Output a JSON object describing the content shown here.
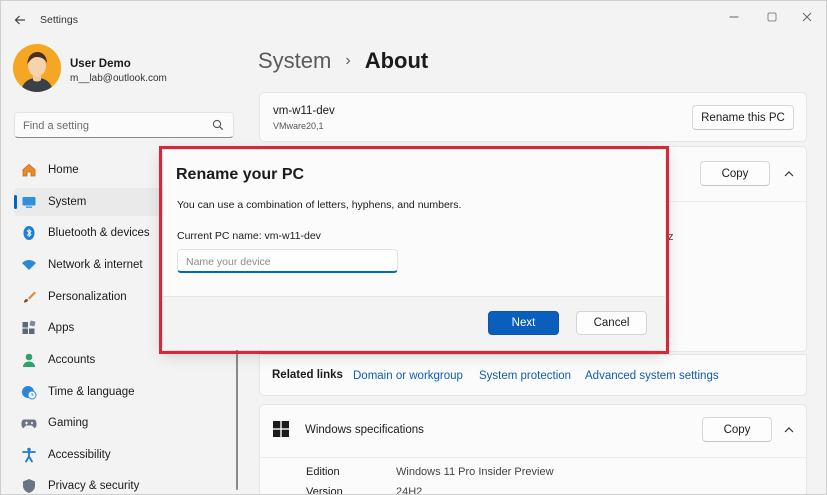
{
  "window": {
    "title": "Settings",
    "back_icon": "arrow-left-icon",
    "controls": [
      "minimize-icon",
      "maximize-icon",
      "close-icon"
    ]
  },
  "user": {
    "name": "User Demo",
    "email": "m__lab@outlook.com"
  },
  "search": {
    "placeholder": "Find a setting",
    "icon": "search-icon"
  },
  "sidebar": {
    "items": [
      {
        "label": "Home",
        "icon": "home-icon",
        "active": false
      },
      {
        "label": "System",
        "icon": "monitor-icon",
        "active": true
      },
      {
        "label": "Bluetooth & devices",
        "icon": "bluetooth-icon",
        "active": false
      },
      {
        "label": "Network & internet",
        "icon": "wifi-icon",
        "active": false
      },
      {
        "label": "Personalization",
        "icon": "brush-icon",
        "active": false
      },
      {
        "label": "Apps",
        "icon": "apps-icon",
        "active": false
      },
      {
        "label": "Accounts",
        "icon": "person-icon",
        "active": false
      },
      {
        "label": "Time & language",
        "icon": "clock-globe-icon",
        "active": false
      },
      {
        "label": "Gaming",
        "icon": "gamepad-icon",
        "active": false
      },
      {
        "label": "Accessibility",
        "icon": "accessibility-icon",
        "active": false
      },
      {
        "label": "Privacy & security",
        "icon": "shield-icon",
        "active": false
      }
    ]
  },
  "breadcrumb": {
    "parent": "System",
    "separator": "›",
    "current": "About"
  },
  "device_card": {
    "name": "vm-w11-dev",
    "model": "VMware20,1",
    "rename_button": "Rename this PC"
  },
  "device_specs": {
    "copy_button": "Copy",
    "partial_text": "z"
  },
  "related_links": {
    "title": "Related links",
    "links": [
      "Domain or workgroup",
      "System protection",
      "Advanced system settings"
    ]
  },
  "windows_specs": {
    "title": "Windows specifications",
    "copy_button": "Copy",
    "rows": [
      {
        "label": "Edition",
        "value": "Windows 11 Pro Insider Preview"
      },
      {
        "label": "Version",
        "value": "24H2"
      }
    ]
  },
  "dialog": {
    "title": "Rename your PC",
    "description": "You can use a combination of letters, hyphens, and numbers.",
    "current_name": "Current PC name: vm-w11-dev",
    "input_placeholder": "Name your device",
    "next_button": "Next",
    "cancel_button": "Cancel",
    "highlight_color": "#d8263a"
  },
  "colors": {
    "accent": "#0067c0",
    "primary_button": "#0a5fbd",
    "link": "#0f5cb5"
  }
}
